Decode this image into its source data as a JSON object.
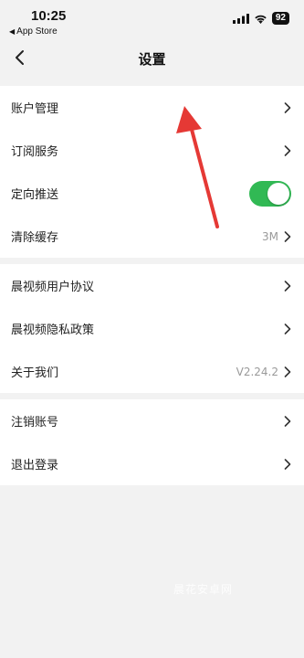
{
  "status_bar": {
    "time": "10:25",
    "back_app": "App Store",
    "battery": "92"
  },
  "nav": {
    "title": "设置",
    "back_icon": "chevron-left-icon"
  },
  "groups": [
    {
      "rows": [
        {
          "label": "账户管理",
          "value": "",
          "type": "link"
        },
        {
          "label": "订阅服务",
          "value": "",
          "type": "link"
        },
        {
          "label": "定向推送",
          "value": "",
          "type": "toggle",
          "on": true
        },
        {
          "label": "清除缓存",
          "value": "3M",
          "type": "link"
        }
      ]
    },
    {
      "rows": [
        {
          "label": "晨视频用户协议",
          "value": "",
          "type": "link"
        },
        {
          "label": "晨视频隐私政策",
          "value": "",
          "type": "link"
        },
        {
          "label": "关于我们",
          "value": "V2.24.2",
          "type": "link"
        }
      ]
    },
    {
      "rows": [
        {
          "label": "注销账号",
          "value": "",
          "type": "link"
        },
        {
          "label": "退出登录",
          "value": "",
          "type": "link"
        }
      ]
    }
  ],
  "watermark": "晨花安卓网",
  "colors": {
    "toggle_on": "#31b954",
    "annotation_arrow": "#e53935"
  }
}
